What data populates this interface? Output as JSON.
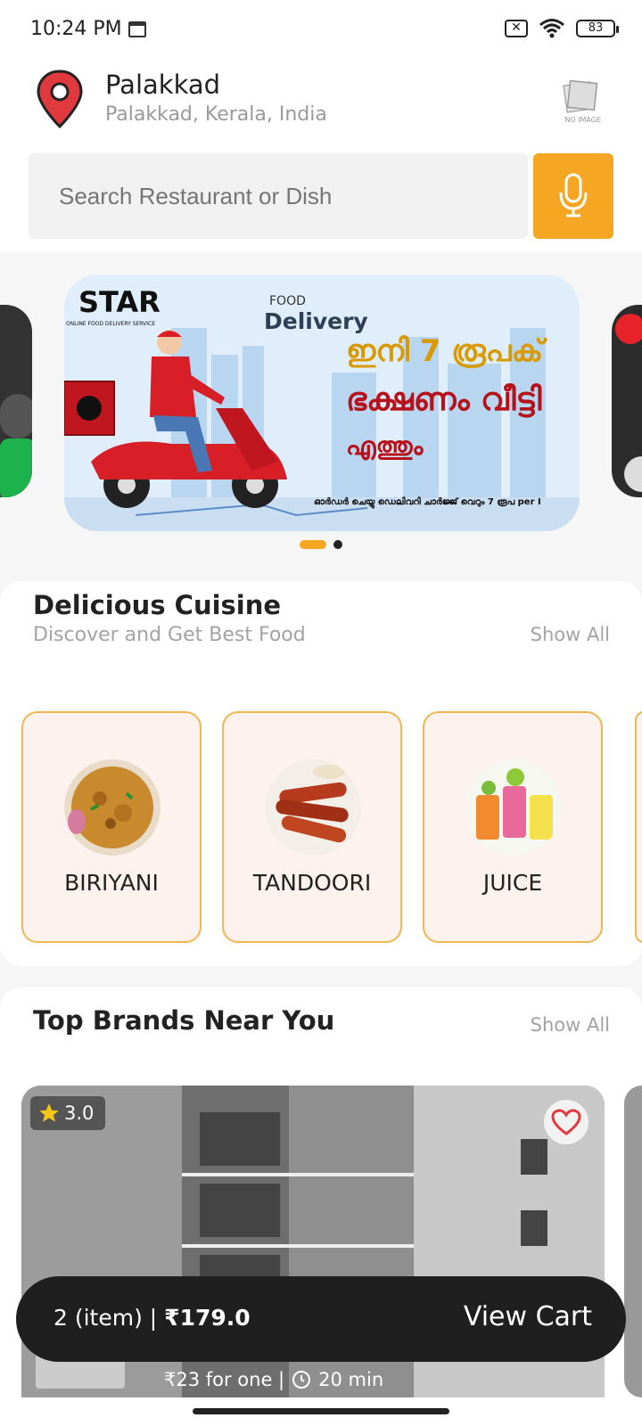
{
  "status": {
    "time": "10:24 PM",
    "battery": "83"
  },
  "location": {
    "title": "Palakkad",
    "subtitle": "Palakkad, Kerala, India",
    "noimage_label": "NO IMAGE"
  },
  "search": {
    "placeholder": "Search Restaurant or Dish"
  },
  "banner": {
    "brand": "STAR",
    "brand_sub": "ONLINE FOOD DELIVERY SERVICE",
    "food": "FOOD",
    "delivery": "Delivery",
    "line1": "ഇനി 7 രൂപക്",
    "line2": "ഭക്ഷണം വീട്ടി",
    "line3": "എത്തും",
    "footer": "ഓർഡർ ചെയ്യു ഡെലിവറി ചാർജ്ജ് വെറും 7 രൂപ per I"
  },
  "cuisine": {
    "title": "Delicious Cuisine",
    "subtitle": "Discover and Get Best Food",
    "show_all": "Show All",
    "items": [
      {
        "name": "BIRIYANI"
      },
      {
        "name": "TANDOORI"
      },
      {
        "name": "JUICE"
      }
    ]
  },
  "brands": {
    "title": "Top Brands Near You",
    "show_all": "Show All",
    "card": {
      "rating": "3.0",
      "price": "₹23 for one |",
      "time": "20 min"
    }
  },
  "cart": {
    "items": "2 (item) |",
    "total": "₹179.0",
    "action": "View Cart"
  },
  "colors": {
    "accent": "#f5a623",
    "pin": "#e0393e",
    "card_bg": "#fdf2ee",
    "card_border": "#f0b650",
    "dark": "#1f1f1f"
  }
}
